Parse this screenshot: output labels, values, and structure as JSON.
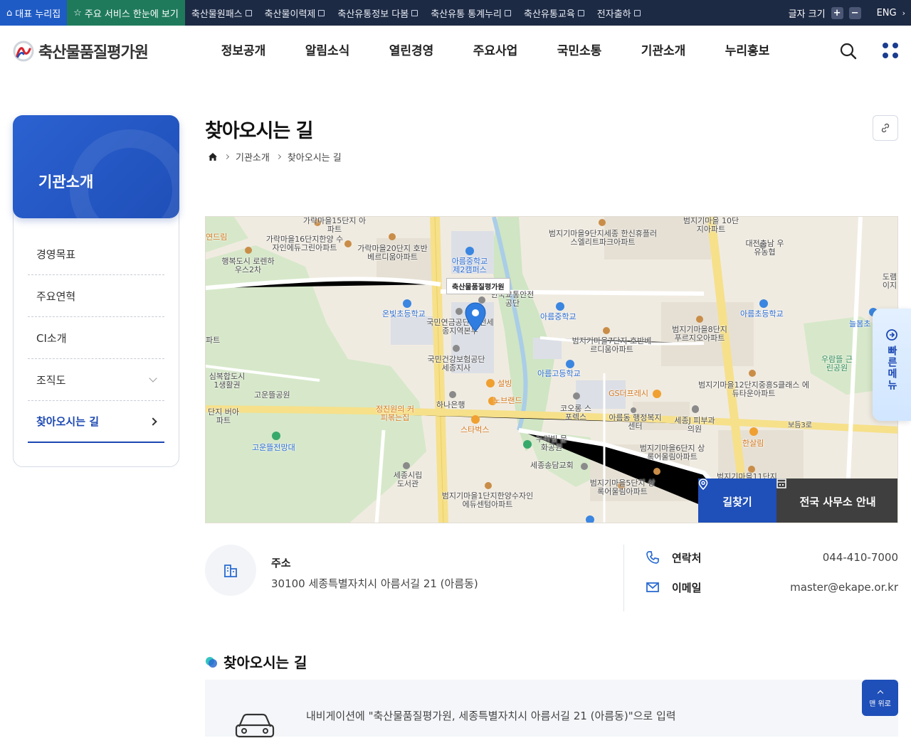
{
  "topbar": {
    "rep_label": "대표 누리집",
    "service_label": "주요 서비스 한눈에 보기",
    "links": [
      "축산물원패스",
      "축산물이력제",
      "축산유통정보 다봄",
      "축산유통 통계누리",
      "축산유통교육",
      "전자출하"
    ],
    "font_size_label": "글자 크기",
    "plus": "+",
    "minus": "−",
    "lang": "ENG"
  },
  "header": {
    "logo_text": "축산물품질평가원",
    "gnb": [
      "정보공개",
      "알림소식",
      "열린경영",
      "주요사업",
      "국민소통",
      "기관소개",
      "누리홍보"
    ]
  },
  "sidebar": {
    "title": "기관소개",
    "items": [
      {
        "label": "경영목표"
      },
      {
        "label": "주요연혁"
      },
      {
        "label": "CI소개"
      },
      {
        "label": "조직도"
      },
      {
        "label": "찾아오시는 길"
      }
    ]
  },
  "page": {
    "title": "찾아오시는 길",
    "breadcrumb": [
      "기관소개",
      "찾아오시는 길"
    ]
  },
  "map": {
    "pin_label": "축산물품질평가원",
    "labels": [
      "가락마을15단지 아파트",
      "가락마을16단지한양 수자인에듀그린아파트",
      "가락마을20단지 호반베르디움아파트",
      "행복도시 로렌하우스2차",
      "범지기마을9단지세종 한신휴플러스엘리트파크아파트",
      "범지기마을 10단지아파트",
      "대전충남 우유농협",
      "아름중학교 제2캠퍼스",
      "한국교통안전공단",
      "온빛초등학교",
      "국민연금공단 대전세종지역본부",
      "아름중학교",
      "아름초등학교",
      "범지기마을8단지 푸르지오아파트",
      "범지기마을7단지 호반베르디움아파트",
      "국민건강보험공단 세종지사",
      "아름고등학교",
      "우람뜰 근린공원",
      "고운뜰공원",
      "설빙",
      "노브랜드",
      "하나은행",
      "GS더프레시",
      "범지기마을12단지중흥S클래스 에듀타운아파트",
      "정진원의 커피볶는집",
      "스타벅스",
      "코오롱 스포렉스",
      "아름동 행정복지센터",
      "세종J 피부과의원",
      "고운뜰전망대",
      "누리빛 문화공원",
      "세종송담교회",
      "범지기마을6단지 상록어울림아파트",
      "한살림",
      "세종시립 도서관",
      "범지기마을1단지한양수자인 에듀센텀아파트",
      "범지기마을5단지 상록어울림아파트",
      "범지기마을11단지",
      "보듬3로",
      "늘봄초",
      "연드림",
      "도램 이지",
      "심복합도시 1생활권",
      "단지 버아파트",
      "파트"
    ],
    "find_route": "길찾기",
    "offices": "전국 사무소 안내"
  },
  "quick_menu": "빠른메뉴",
  "info": {
    "address_label": "주소",
    "address": "30100 세종특별자치시 아름서길 21 (아름동)",
    "phone_label": "연락처",
    "phone": "044-410-7000",
    "email_label": "이메일",
    "email": "master@ekape.or.kr"
  },
  "section": {
    "title": "찾아오시는 길",
    "nav_text": "내비게이션에 \"축산물품질평가원, 세종특별자치시 아름서길 21 (아름동)\"으로 입력"
  },
  "top_button": "맨 위로",
  "colors": {
    "primary": "#1f4fb8",
    "topbar": "#1d2a44",
    "service": "#1f7a5c",
    "dark_button": "#3f3f3f"
  }
}
